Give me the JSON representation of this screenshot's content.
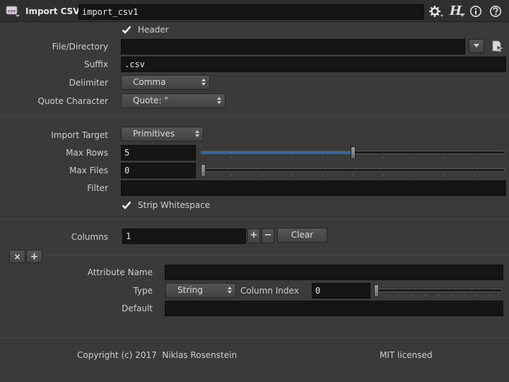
{
  "node": {
    "type_label": "Import CSV",
    "name": "import_csv1",
    "icon": "csv-node-icon",
    "help_glyph": "H"
  },
  "params": {
    "header": {
      "label": "Header",
      "checked": true
    },
    "file_directory": {
      "label": "File/Directory",
      "value": ""
    },
    "suffix": {
      "label": "Suffix",
      "value": ".csv"
    },
    "delimiter": {
      "label": "Delimiter",
      "value": "Comma"
    },
    "quote_character": {
      "label": "Quote Character",
      "value": "Quote: \""
    },
    "import_target": {
      "label": "Import Target",
      "value": "Primitives"
    },
    "max_rows": {
      "label": "Max Rows",
      "value": "5",
      "slider_fraction": 0.5
    },
    "max_files": {
      "label": "Max Files",
      "value": "0",
      "slider_fraction": 0.0
    },
    "filter": {
      "label": "Filter",
      "value": ""
    },
    "strip_whitespace": {
      "label": "Strip Whitespace",
      "checked": true
    },
    "columns": {
      "label": "Columns",
      "value": "1",
      "add": "+",
      "remove": "−",
      "clear": "Clear"
    },
    "multiparm": {
      "remove_glyph": "×",
      "insert_glyph": "+"
    },
    "attribute_name": {
      "label": "Attribute Name",
      "value": ""
    },
    "type": {
      "label": "Type",
      "value": "String"
    },
    "column_index": {
      "label": "Column Index",
      "value": "0",
      "slider_fraction": 0.0
    },
    "default": {
      "label": "Default",
      "value": ""
    }
  },
  "footer": {
    "copyright": "Copyright (c) 2017  Niklas Rosenstein",
    "license": "MIT licensed"
  },
  "colors": {
    "background": "#3a3a3a",
    "field": "#151515",
    "slider_fill": "#2f6aa7"
  }
}
